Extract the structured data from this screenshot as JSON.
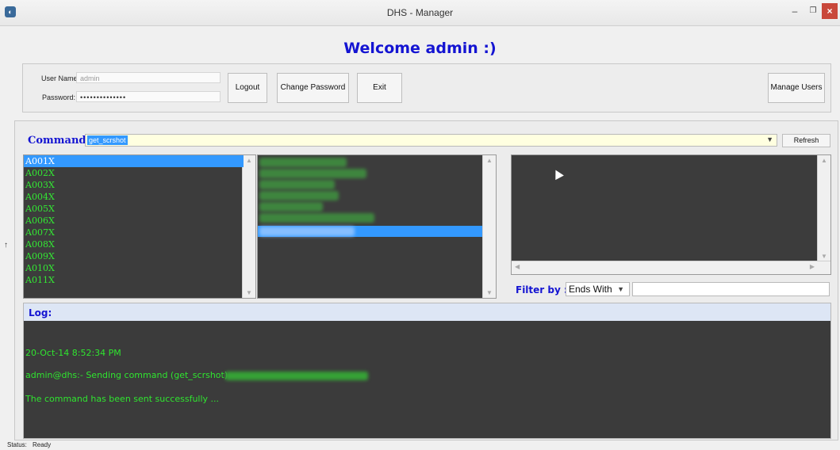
{
  "window": {
    "title": "DHS - Manager"
  },
  "welcome": "Welcome admin :)",
  "login": {
    "username_label": "User Name:",
    "username_value": "admin",
    "password_label": "Password:",
    "password_value": "••••••••••••••"
  },
  "buttons": {
    "logout": "Logout",
    "change_password": "Change Password",
    "exit": "Exit",
    "manage_users": "Manage Users",
    "refresh": "Refresh"
  },
  "command": {
    "label": "Command:",
    "value": "get_scrshot"
  },
  "devices": [
    "A001X",
    "A002X",
    "A003X",
    "A004X",
    "A005X",
    "A006X",
    "A007X",
    "A008X",
    "A009X",
    "A010X",
    "A011X"
  ],
  "selected_device": "A001X",
  "filter": {
    "label": "Filter by :",
    "option": "Ends With",
    "text": ""
  },
  "log": {
    "label": "Log:",
    "lines": [
      "20-Oct-14 8:52:34 PM",
      "admin@dhs:- Sending command (get_scrshot)",
      "The command has been sent successfully ..."
    ]
  },
  "status": {
    "label": "Status:",
    "value": "Ready"
  },
  "colors": {
    "heading_blue": "#1414d2",
    "list_bg": "#3c3c3c",
    "list_text_green": "#33e833",
    "selection_blue": "#3399ff"
  }
}
